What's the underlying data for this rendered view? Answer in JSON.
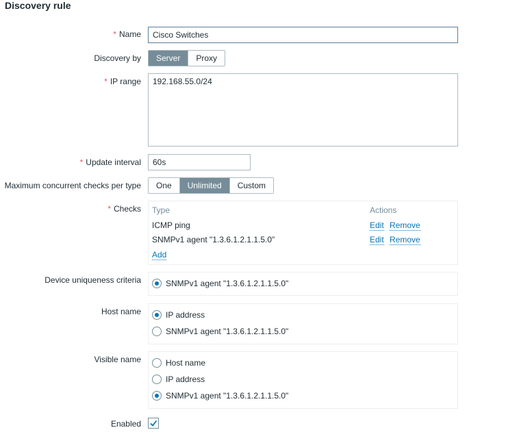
{
  "form": {
    "title": "Discovery rule",
    "required_marker": "*",
    "name": {
      "label": "Name",
      "value": "Cisco Switches"
    },
    "discovery_by": {
      "label": "Discovery by",
      "options": [
        "Server",
        "Proxy"
      ],
      "selected": "Server"
    },
    "ip_range": {
      "label": "IP range",
      "value": "192.168.55.0/24"
    },
    "update_interval": {
      "label": "Update interval",
      "value": "60s"
    },
    "max_checks": {
      "label": "Maximum concurrent checks per type",
      "options": [
        "One",
        "Unlimited",
        "Custom"
      ],
      "selected": "Unlimited"
    },
    "checks": {
      "label": "Checks",
      "columns": [
        "Type",
        "Actions"
      ],
      "rows": [
        {
          "type": "ICMP ping",
          "edit": "Edit",
          "remove": "Remove"
        },
        {
          "type": "SNMPv1 agent \"1.3.6.1.2.1.1.5.0\"",
          "edit": "Edit",
          "remove": "Remove"
        }
      ],
      "add_label": "Add"
    },
    "uniqueness": {
      "label": "Device uniqueness criteria",
      "options": [
        {
          "label": "SNMPv1 agent \"1.3.6.1.2.1.1.5.0\"",
          "selected": true
        }
      ]
    },
    "host_name": {
      "label": "Host name",
      "options": [
        {
          "label": "IP address",
          "selected": true
        },
        {
          "label": "SNMPv1 agent \"1.3.6.1.2.1.1.5.0\"",
          "selected": false
        }
      ]
    },
    "visible_name": {
      "label": "Visible name",
      "options": [
        {
          "label": "Host name",
          "selected": false
        },
        {
          "label": "IP address",
          "selected": false
        },
        {
          "label": "SNMPv1 agent \"1.3.6.1.2.1.1.5.0\"",
          "selected": true
        }
      ]
    },
    "enabled": {
      "label": "Enabled",
      "checked": true
    }
  },
  "colors": {
    "accent": "#768d99",
    "link": "#0275b8",
    "required": "#e45959"
  }
}
